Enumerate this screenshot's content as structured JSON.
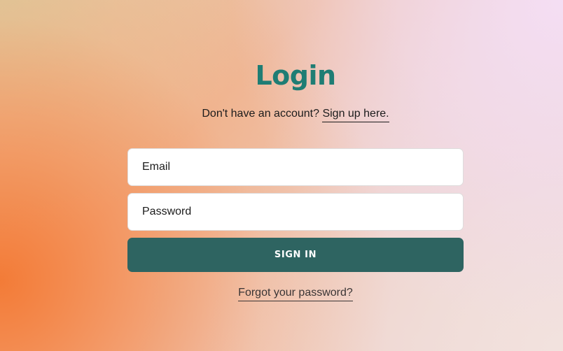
{
  "page": {
    "title": "Login",
    "signup_prompt": "Don't have an account?",
    "signup_link": "Sign up here."
  },
  "form": {
    "email_placeholder": "Email",
    "password_placeholder": "Password",
    "submit_label": "SIGN IN",
    "forgot_link": "Forgot your password?"
  },
  "colors": {
    "title": "#1f7d74",
    "button": "#2e6461",
    "button_text": "#ffffff",
    "input_background": "#ffffff"
  }
}
